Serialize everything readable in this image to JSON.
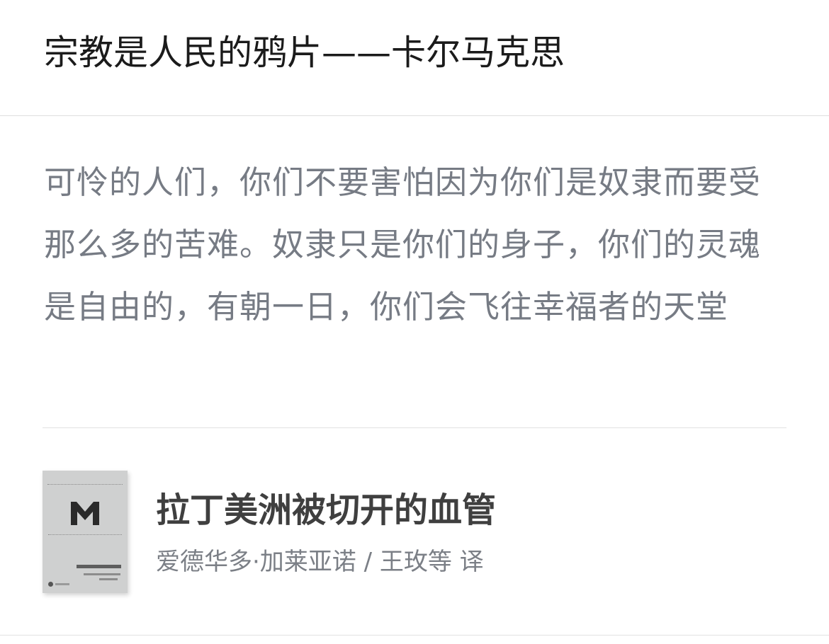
{
  "header": {
    "title": "宗教是人民的鸦片——卡尔马克思"
  },
  "quote": {
    "text": "可怜的人们，你们不要害怕因为你们是奴隶而要受那么多的苦难。奴隶只是你们的身子，你们的灵魂是自由的，有朝一日，你们会飞往幸福者的天堂"
  },
  "book": {
    "title": "拉丁美洲被切开的血管",
    "author": "爱德华多·加莱亚诺 / 王玫等 译",
    "cover": {
      "logo_icon": "m-logo-icon",
      "background": "#cfd0d0"
    }
  },
  "colors": {
    "title_text": "#1b1b1b",
    "quote_text": "#767b84",
    "book_title": "#3f3f3f",
    "book_author": "#7b7f86",
    "divider": "#e2e2e2"
  }
}
